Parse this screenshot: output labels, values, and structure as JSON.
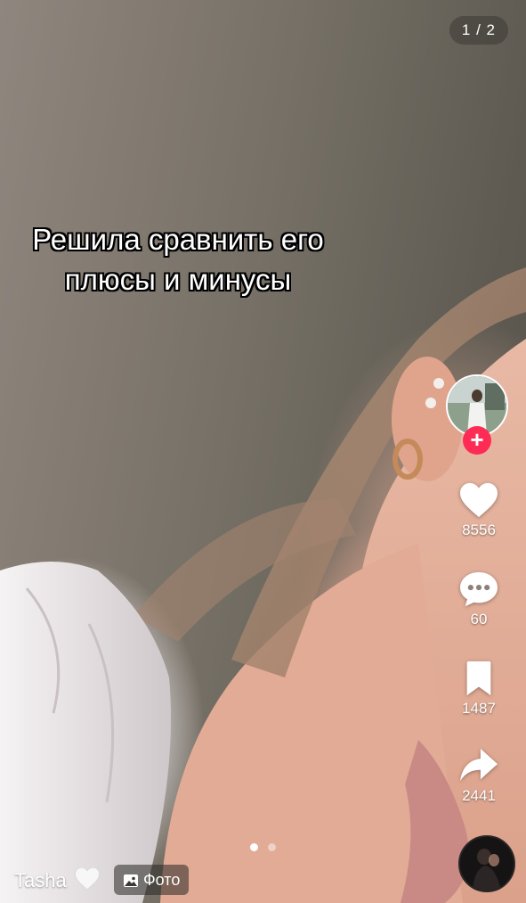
{
  "post": {
    "counter": "1 / 2",
    "caption_line1": "Решила сравнить его",
    "caption_line2": "плюсы и минусы"
  },
  "actions": {
    "likes": "8556",
    "comments": "60",
    "saves": "1487",
    "shares": "2441"
  },
  "author": {
    "username": "Tasha",
    "follow_symbol": "+"
  },
  "content_type": {
    "label": "Фото"
  },
  "carousel": {
    "total": 2,
    "current": 1
  },
  "colors": {
    "follow_accent": "#fe2c55",
    "icon": "#ffffff"
  },
  "icons": [
    "heart-icon",
    "comment-icon",
    "bookmark-icon",
    "share-icon",
    "image-icon",
    "white-heart-emoji-icon",
    "plus-icon"
  ]
}
